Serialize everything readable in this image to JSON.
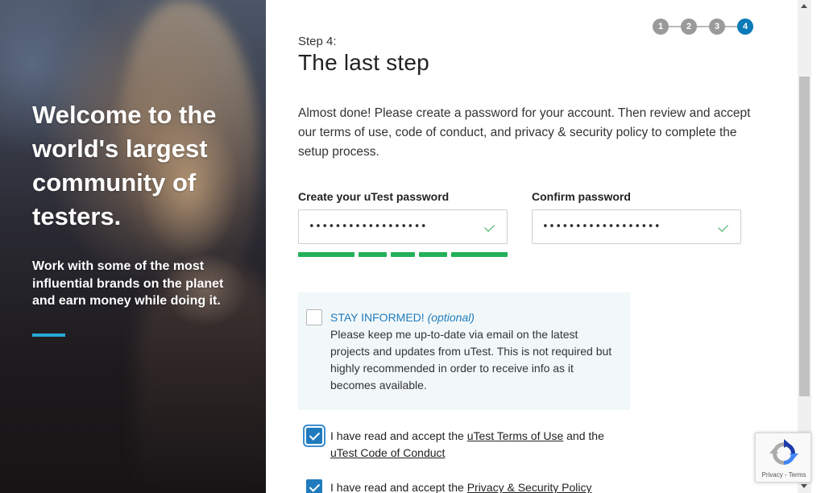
{
  "hero": {
    "title": "Welcome to the world's largest community of testers.",
    "subtitle": "Work with some of the most influential brands on the planet and earn money while doing it."
  },
  "stepper": {
    "steps": [
      "1",
      "2",
      "3",
      "4"
    ],
    "active_step": "4"
  },
  "form": {
    "step_label": "Step 4:",
    "step_title": "The last step",
    "intro": "Almost done! Please create a password for your account. Then review and accept our terms of use, code of conduct, and privacy & security policy to complete the setup process.",
    "password": {
      "label": "Create your uTest password",
      "value": "••••••••••••••••••"
    },
    "confirm_password": {
      "label": "Confirm password",
      "value": "••••••••••••••••••"
    },
    "password_strength": 1.0,
    "stay_informed": {
      "heading": "STAY INFORMED!",
      "optional": "(optional)",
      "text": "Please keep me up-to-date via email on the latest projects and updates from uTest. This is not required but highly recommended in order to receive info as it becomes available.",
      "checked": false
    },
    "terms": {
      "prefix": "I have read and accept the ",
      "terms_link": "uTest Terms of Use",
      "middle": " and the ",
      "conduct_link": "uTest Code of Conduct",
      "checked": true
    },
    "privacy": {
      "prefix": "I have read and accept the ",
      "privacy_link": "Privacy & Security Policy",
      "checked": true
    }
  },
  "recaptcha": {
    "links": "Privacy - Terms"
  },
  "colors": {
    "accent_blue": "#1f7bbd",
    "step_active": "#0a7ab8",
    "strength_green": "#22b15a",
    "hero_accent": "#27a9d6"
  }
}
